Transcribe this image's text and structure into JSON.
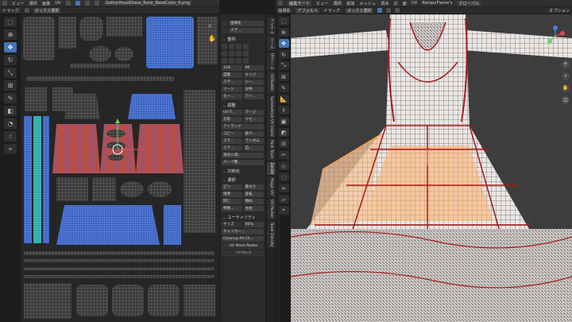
{
  "uv_header": {
    "drag_label": "ドラッグ:",
    "select_box_label": "ボックス選択",
    "menu": [
      "ビュー",
      "選択",
      "画像",
      "UV"
    ],
    "image_name": "GothicHeadDress_Rose_BaseColor_R.png"
  },
  "npanel": {
    "sections": {
      "align": "整列",
      "adjust": "調整",
      "symmetry": "対称化",
      "select": "選択",
      "utility": "ユーティリティ"
    },
    "items": {
      "straighten": "直線化",
      "stitch": "ステ...",
      "val_118": "118",
      "val_90": "90",
      "auto": "自動",
      "edge": "エッジ",
      "seal": "ステ...",
      "seam": "シー...",
      "sort": "ソート",
      "split": "分布",
      "mode": "モー...",
      "island": "アイ...",
      "uv_mirror": "UVマ...",
      "merge": "マージ",
      "rect": "方形",
      "reset": "リセ...",
      "island2": "アイランド",
      "copy": "コピー",
      "paste": "貼り...",
      "smart": "スマ...",
      "randomize": "ランダム",
      "straighten2": "ステ...",
      "snap": "自...",
      "apply_text": "頂点に適..."
    },
    "select_labels": {
      "pin": "ピン",
      "overlap": "重なり",
      "border": "境界",
      "flip": "反転",
      "same": "同じ",
      "similar": "類似",
      "special": "特殊...",
      "reverse": "逆転",
      "move": "移動",
      "lr": "左右"
    },
    "size_label": "サイズ",
    "size_value": "60%",
    "checker_label": "チェッカー...",
    "cleanup_label": "Cleanup All Ch...",
    "uv_mesh_nodes": "UV Mesh Nodes",
    "uv_mesh_sub": "UV Mesh"
  },
  "uv_side_tabs": [
    "アイテム",
    "ツール",
    "UVツール",
    "UVToolkit",
    "Symmetrize UV Island",
    "Pack Tools",
    "ZenUV",
    "Magic UV",
    "UV Packer",
    "Texel Density"
  ],
  "vp_side_tabs": [
    "アイテム",
    "ツール",
    "ビュー",
    "選択編集"
  ],
  "vp_header": {
    "mode_label": "編集モード",
    "menu": [
      "ビュー",
      "選択",
      "追加",
      "メッシュ",
      "頂点",
      "辺",
      "面",
      "UV"
    ],
    "addon": "RetopoFlame's",
    "orientation": "グローバル",
    "transform_label": "座標系:",
    "default_label": "デフォルト",
    "drag_label": "ドラッグ:",
    "select_box_label": "ボックス選択",
    "options_label": "オプション"
  },
  "colors": {
    "accent": "#4772b3",
    "uv_red": "#d2533b",
    "uv_blue": "#3a63c4",
    "seam_red": "#a61c1c",
    "selected_face": "#f3c9a0"
  }
}
